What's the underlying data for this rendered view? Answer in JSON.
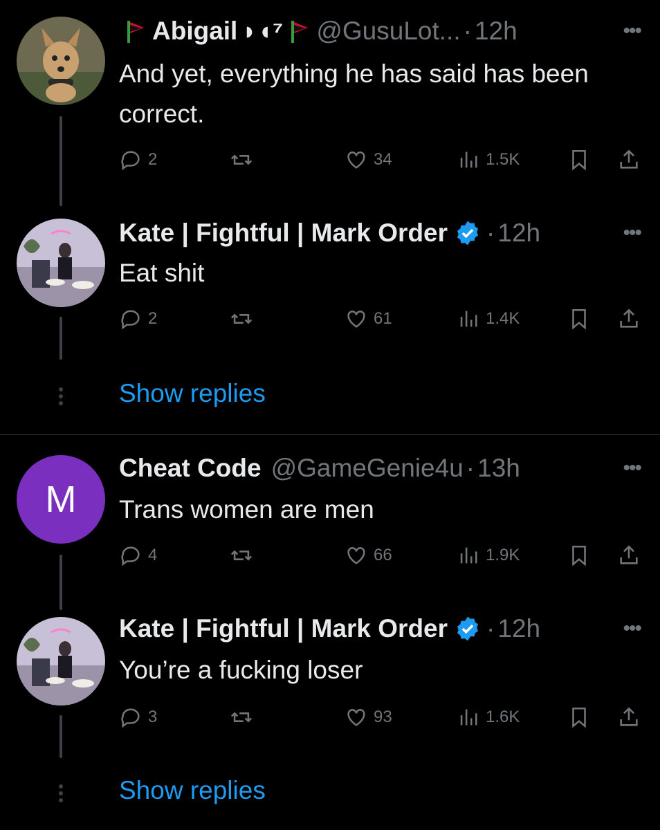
{
  "tweets": [
    {
      "name": "Abigail",
      "name_extra": "⁷",
      "handle": "@GusuLot...",
      "time": "12h",
      "text": "And yet, everything he has said has been correct.",
      "replies": "2",
      "likes": "34",
      "views": "1.5K"
    },
    {
      "name": "Kate | Fightful | Mark Order",
      "time": "12h",
      "text": "Eat shit",
      "replies": "2",
      "likes": "61",
      "views": "1.4K"
    },
    {
      "name": "Cheat Code",
      "handle": "@GameGenie4u",
      "time": "13h",
      "avatar_letter": "M",
      "text": "Trans women are men",
      "replies": "4",
      "likes": "66",
      "views": "1.9K"
    },
    {
      "name": "Kate | Fightful | Mark Order",
      "time": "12h",
      "text": "You’re a fucking loser",
      "replies": "3",
      "likes": "93",
      "views": "1.6K"
    }
  ],
  "show_replies_label": "Show replies",
  "separator_dot": "·",
  "colors": {
    "accent": "#1d9bf0",
    "muted": "#71767b",
    "avatar_purple": "#7b2fbe"
  }
}
